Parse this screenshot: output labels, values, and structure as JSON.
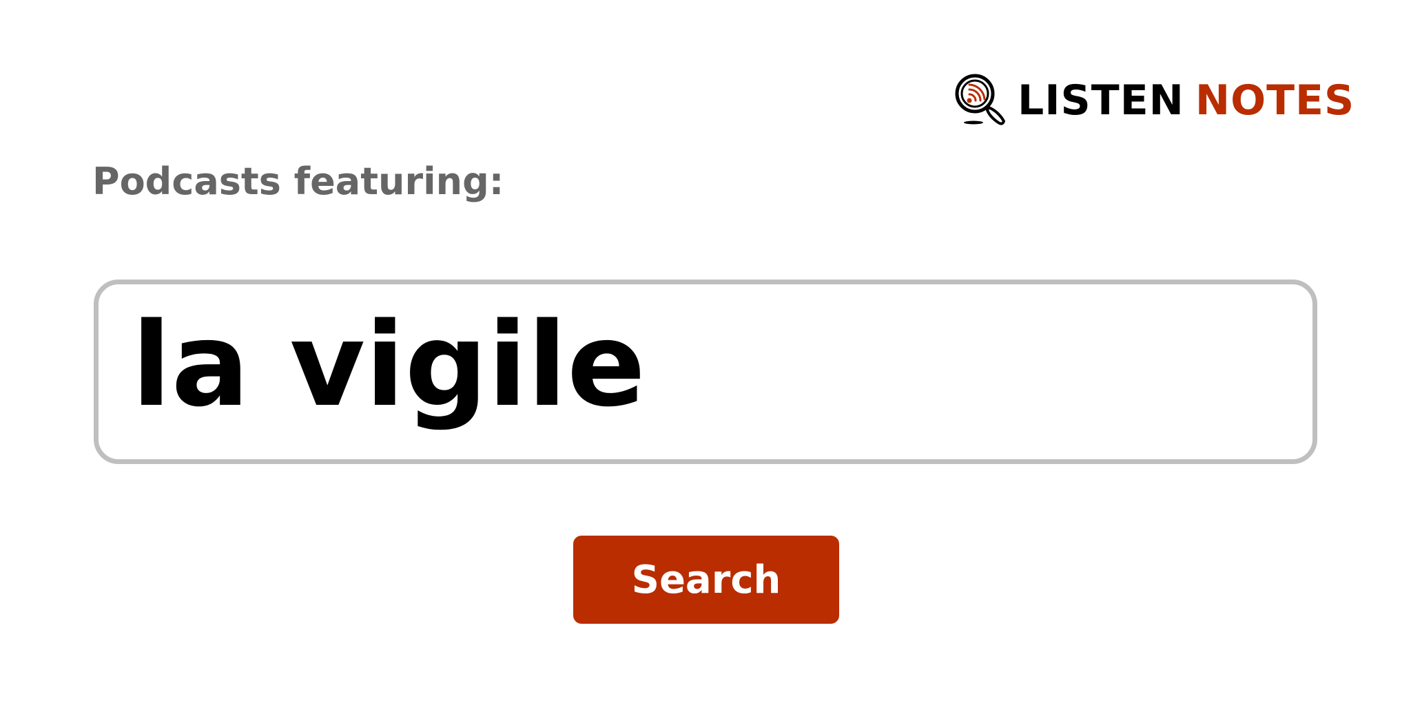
{
  "logo": {
    "icon": "podcast-search-icon",
    "word1": "LISTEN",
    "word2": "NOTES",
    "colors": {
      "word1": "#000000",
      "word2": "#b92d00"
    }
  },
  "heading": "Podcasts featuring:",
  "search": {
    "value": "la vigile",
    "button_label": "Search"
  },
  "colors": {
    "accent": "#b92d00",
    "heading_text": "#666666",
    "input_border": "#bfbfbf"
  }
}
